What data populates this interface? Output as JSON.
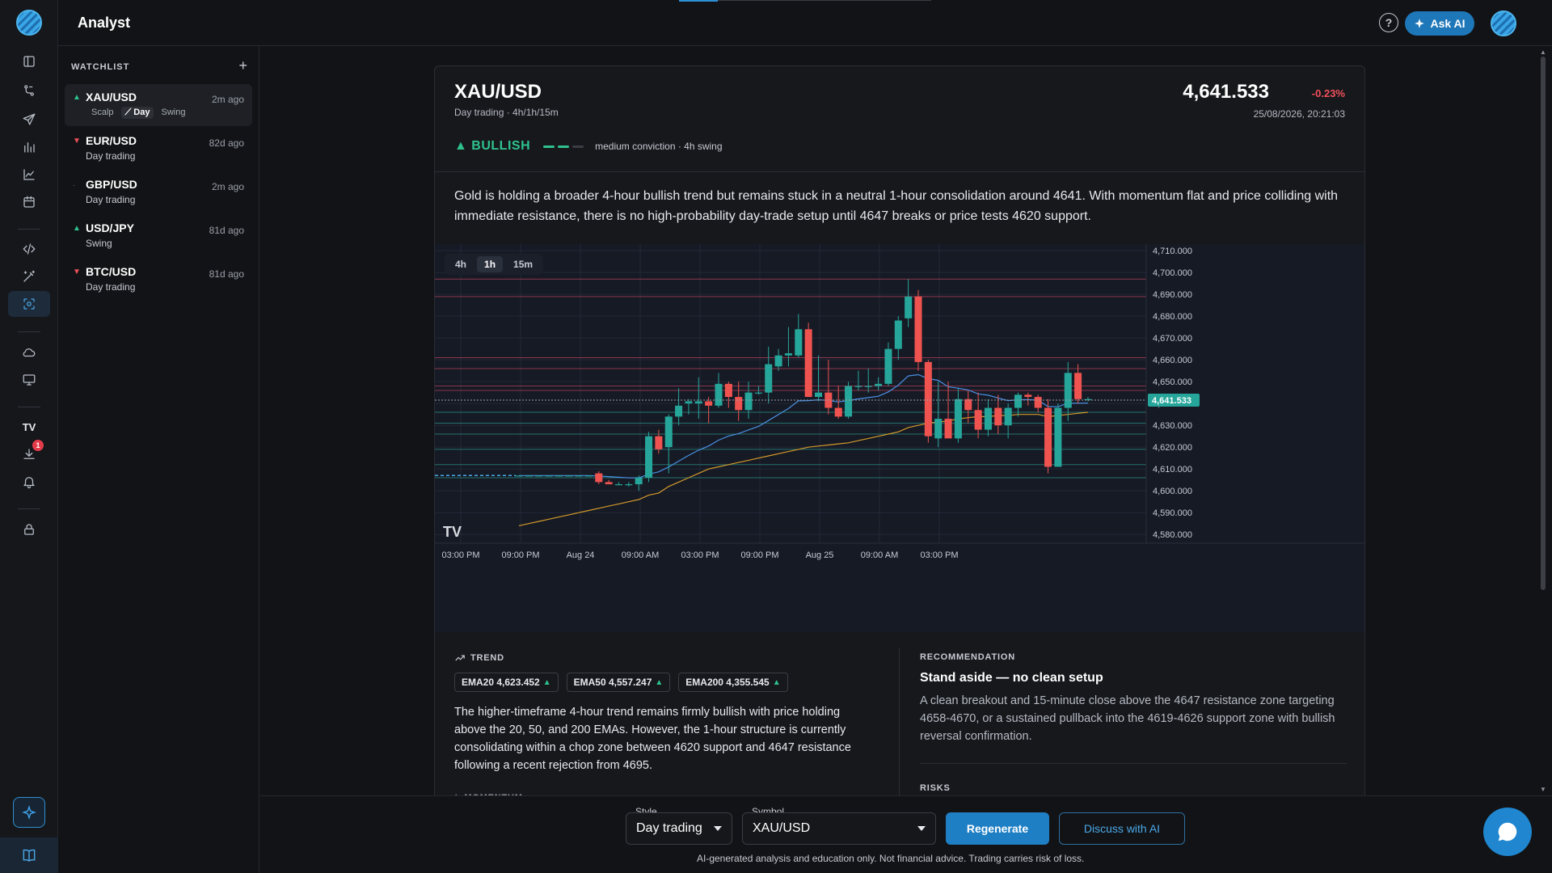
{
  "app": {
    "title": "Analyst",
    "ask_ai_label": "Ask AI",
    "help_glyph": "?"
  },
  "rail": {
    "notification_count": "1"
  },
  "watchlist": {
    "heading": "WATCHLIST",
    "add_glyph": "+",
    "items": [
      {
        "symbol": "XAU/USD",
        "ago": "2m ago",
        "direction": "up",
        "modes": [
          "Scalp",
          "Day",
          "Swing"
        ],
        "active_mode": "Day"
      },
      {
        "symbol": "EUR/USD",
        "ago": "82d ago",
        "direction": "down",
        "style": "Day trading"
      },
      {
        "symbol": "GBP/USD",
        "ago": "2m ago",
        "direction": "neutral",
        "style": "Day trading"
      },
      {
        "symbol": "USD/JPY",
        "ago": "81d ago",
        "direction": "up",
        "style": "Swing"
      },
      {
        "symbol": "BTC/USD",
        "ago": "81d ago",
        "direction": "down",
        "style": "Day trading"
      }
    ]
  },
  "analysis": {
    "symbol": "XAU/USD",
    "meta": "Day trading · 4h/1h/15m",
    "price": "4,641.533",
    "change": "-0.23%",
    "timestamp": "25/08/2026, 20:21:03",
    "bias": "BULLISH",
    "bias_glyph": "▲",
    "conviction": "medium conviction · 4h swing",
    "conviction_level": 2,
    "conviction_max": 3,
    "summary": "Gold is holding a broader 4-hour bullish trend but remains stuck in a neutral 1-hour consolidation around 4641. With momentum flat and price colliding with immediate resistance, there is no high-probability day-trade setup until 4647 breaks or price tests 4620 support."
  },
  "chart": {
    "timeframes": [
      "4h",
      "1h",
      "15m"
    ],
    "active_timeframe": "1h",
    "last_price_label": "4,641.533",
    "watermark": "TV"
  },
  "chart_data": {
    "type": "candlestick",
    "title": "",
    "x_ticks": [
      "03:00 PM",
      "09:00 PM",
      "Aug 24",
      "09:00 AM",
      "03:00 PM",
      "09:00 PM",
      "Aug 25",
      "09:00 AM",
      "03:00 PM"
    ],
    "y_ticks": [
      "4,710.000",
      "4,700.000",
      "4,690.000",
      "4,680.000",
      "4,670.000",
      "4,660.000",
      "4,650.000",
      "4,640.000",
      "4,630.000",
      "4,620.000",
      "4,610.000",
      "4,600.000",
      "4,590.000",
      "4,580.000"
    ],
    "ylim": [
      4576,
      4713
    ],
    "last_price": 4641.533,
    "resistance_levels": [
      4697,
      4689,
      4661,
      4656,
      4648,
      4646
    ],
    "support_levels": [
      4636,
      4631,
      4626,
      4619,
      4612,
      4606
    ],
    "candles": [
      [
        4607,
        4607,
        4607,
        4607
      ],
      [
        4607,
        4607,
        4607,
        4607
      ],
      [
        4607,
        4607,
        4607,
        4607
      ],
      [
        4607,
        4607,
        4607,
        4607
      ],
      [
        4607,
        4607,
        4607,
        4607
      ],
      [
        4607,
        4607,
        4607,
        4607
      ],
      [
        4607,
        4607,
        4607,
        4607
      ],
      [
        4607,
        4607,
        4607,
        4607
      ],
      [
        4608,
        4609,
        4603,
        4604
      ],
      [
        4604,
        4605,
        4603,
        4603
      ],
      [
        4603,
        4604,
        4603,
        4603
      ],
      [
        4603,
        4604,
        4602,
        4603
      ],
      [
        4603,
        4607,
        4600,
        4606
      ],
      [
        4606,
        4627,
        4604,
        4625
      ],
      [
        4625,
        4628,
        4617,
        4619
      ],
      [
        4620,
        4635,
        4608,
        4634
      ],
      [
        4634,
        4647,
        4630,
        4639
      ],
      [
        4640,
        4642,
        4635,
        4641
      ],
      [
        4640,
        4652,
        4633,
        4641
      ],
      [
        4641,
        4643,
        4631,
        4639
      ],
      [
        4639,
        4654,
        4638,
        4649
      ],
      [
        4649,
        4650,
        4638,
        4643
      ],
      [
        4643,
        4650,
        4632,
        4637
      ],
      [
        4637,
        4650,
        4633,
        4645
      ],
      [
        4645,
        4648,
        4644,
        4645
      ],
      [
        4645,
        4666,
        4640,
        4658
      ],
      [
        4657,
        4665,
        4655,
        4662
      ],
      [
        4662,
        4675,
        4657,
        4663
      ],
      [
        4662,
        4681,
        4661,
        4674
      ],
      [
        4674,
        4677,
        4643,
        4643
      ],
      [
        4643,
        4662,
        4641,
        4645
      ],
      [
        4645,
        4660,
        4635,
        4638
      ],
      [
        4638,
        4648,
        4633,
        4634
      ],
      [
        4634,
        4650,
        4633,
        4648
      ],
      [
        4648,
        4655,
        4646,
        4648
      ],
      [
        4648,
        4656,
        4645,
        4648
      ],
      [
        4648,
        4652,
        4646,
        4649
      ],
      [
        4649,
        4668,
        4648,
        4665
      ],
      [
        4665,
        4680,
        4660,
        4678
      ],
      [
        4679,
        4697,
        4675,
        4689
      ],
      [
        4689,
        4692,
        4655,
        4659
      ],
      [
        4659,
        4660,
        4622,
        4625
      ],
      [
        4624,
        4650,
        4620,
        4633
      ],
      [
        4633,
        4650,
        4626,
        4624
      ],
      [
        4624,
        4647,
        4622,
        4642
      ],
      [
        4642,
        4646,
        4631,
        4637
      ],
      [
        4637,
        4645,
        4624,
        4628
      ],
      [
        4628,
        4642,
        4625,
        4638
      ],
      [
        4638,
        4644,
        4626,
        4630
      ],
      [
        4630,
        4640,
        4624,
        4638
      ],
      [
        4638,
        4645,
        4634,
        4644
      ],
      [
        4644,
        4645,
        4639,
        4643
      ],
      [
        4643,
        4644,
        4636,
        4638
      ],
      [
        4638,
        4642,
        4608,
        4611
      ],
      [
        4611,
        4640,
        4611,
        4638
      ],
      [
        4638,
        4659,
        4632,
        4654
      ],
      [
        4654,
        4658,
        4640,
        4642
      ],
      [
        4642,
        4643,
        4641,
        4642
      ]
    ],
    "series": [
      {
        "name": "EMA20",
        "color": "#4a90e2",
        "values": [
          4607,
          4607,
          4607,
          4607,
          4607,
          4607,
          4607,
          4607,
          4606.8,
          4606.5,
          4606.2,
          4605.9,
          4605.9,
          4607.6,
          4608.7,
          4610.9,
          4613.6,
          4616.2,
          4618.6,
          4620.5,
          4623.2,
          4625.1,
          4626.2,
          4627.9,
          4629.5,
          4632.2,
          4635.0,
          4637.7,
          4641.2,
          4641.3,
          4641.7,
          4641.4,
          4640.7,
          4641.4,
          4642.1,
          4642.7,
          4643.3,
          4645.3,
          4648.4,
          4652.6,
          4653.2,
          4651.4,
          4650.6,
          4647.6,
          4647.0,
          4646.2,
          4644.4,
          4643.8,
          4642.5,
          4641.3,
          4641.7,
          4641.8,
          4641.5,
          4638.6,
          4638.5,
          4640.2,
          4640.1,
          4640.2
        ]
      },
      {
        "name": "EMA50",
        "color": "#d49a2a",
        "values": [
          4584,
          4585,
          4586,
          4587,
          4588,
          4589,
          4590,
          4591,
          4592,
          4593,
          4594,
          4595,
          4596,
          4598,
          4599,
          4602,
          4604,
          4606,
          4608,
          4610,
          4611,
          4612,
          4613,
          4614,
          4615,
          4616,
          4617,
          4618,
          4619,
          4620,
          4620.5,
          4621,
          4621.5,
          4622,
          4623,
          4624,
          4625,
          4626,
          4627,
          4629,
          4630,
          4631,
          4631.5,
          4632,
          4633,
          4633.5,
          4634,
          4634,
          4634.5,
          4634.5,
          4635,
          4635,
          4635,
          4634,
          4634.5,
          4635,
          4635.5,
          4636
        ]
      }
    ]
  },
  "trend": {
    "heading": "TREND",
    "emas": [
      {
        "label": "EMA20 4,623.452",
        "arrow": "▲"
      },
      {
        "label": "EMA50 4,557.247",
        "arrow": "▲"
      },
      {
        "label": "EMA200 4,355.545",
        "arrow": "▲"
      }
    ],
    "text": "The higher-timeframe 4-hour trend remains firmly bullish with price holding above the 20, 50, and 200 EMAs. However, the 1-hour structure is currently consolidating within a chop zone between 4620 support and 4647 resistance following a recent rejection from 4695."
  },
  "momentum": {
    "heading": "MOMENTUM"
  },
  "recommendation": {
    "heading": "RECOMMENDATION",
    "title": "Stand aside — no clean setup",
    "text": "A clean breakout and 15-minute close above the 4647 resistance zone targeting 4658-4670, or a sustained pullback into the 4619-4626 support zone with bullish reversal confirmation."
  },
  "risks": {
    "heading": "RISKS"
  },
  "controls": {
    "style_label": "Style",
    "style_value": "Day trading",
    "symbol_label": "Symbol",
    "symbol_value": "XAU/USD",
    "regenerate_label": "Regenerate",
    "discuss_label": "Discuss with AI",
    "disclaimer": "AI-generated analysis and education only. Not financial advice. Trading carries risk of loss."
  }
}
